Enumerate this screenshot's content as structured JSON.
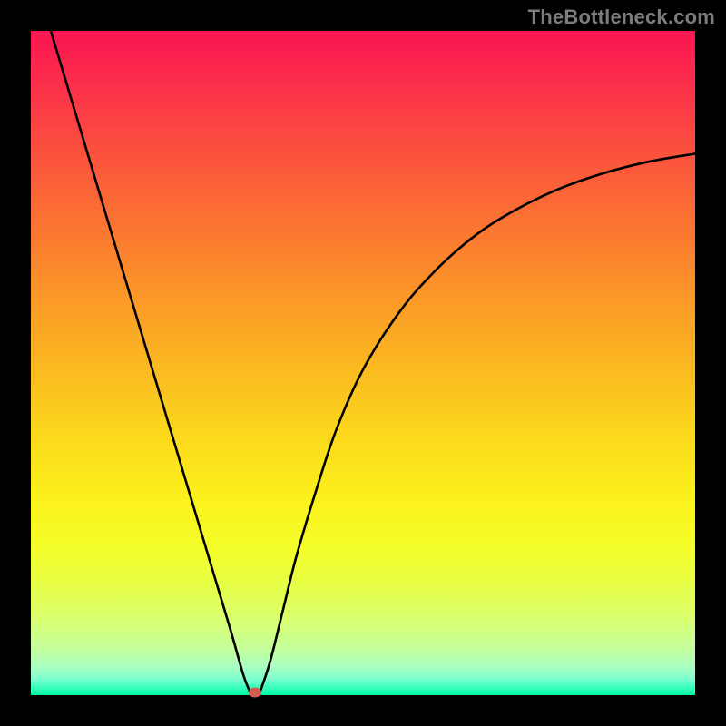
{
  "watermark": "TheBottleneck.com",
  "chart_data": {
    "type": "line",
    "title": "",
    "xlabel": "",
    "ylabel": "",
    "xlim": [
      0,
      100
    ],
    "ylim": [
      0,
      100
    ],
    "background_gradient": {
      "top": "#fa1552",
      "bottom": "#00f59e",
      "note": "vertical red-to-green rainbow gradient"
    },
    "series": [
      {
        "name": "left-branch",
        "x": [
          3,
          6,
          9,
          12,
          15,
          18,
          21,
          24,
          27,
          30,
          32,
          33
        ],
        "values": [
          100,
          90,
          80,
          70,
          60,
          50,
          40,
          30,
          20,
          10,
          3,
          0.5
        ]
      },
      {
        "name": "right-branch",
        "x": [
          34.5,
          36,
          38,
          40,
          43,
          46,
          50,
          55,
          60,
          66,
          72,
          79,
          86,
          93,
          100
        ],
        "values": [
          0.5,
          5,
          13,
          21,
          31,
          40,
          49,
          57,
          63,
          68.5,
          72.5,
          76,
          78.5,
          80.3,
          81.5
        ]
      }
    ],
    "marker": {
      "name": "bottleneck-point",
      "x": 33.7,
      "y": 0,
      "color": "#d35c4f"
    }
  }
}
